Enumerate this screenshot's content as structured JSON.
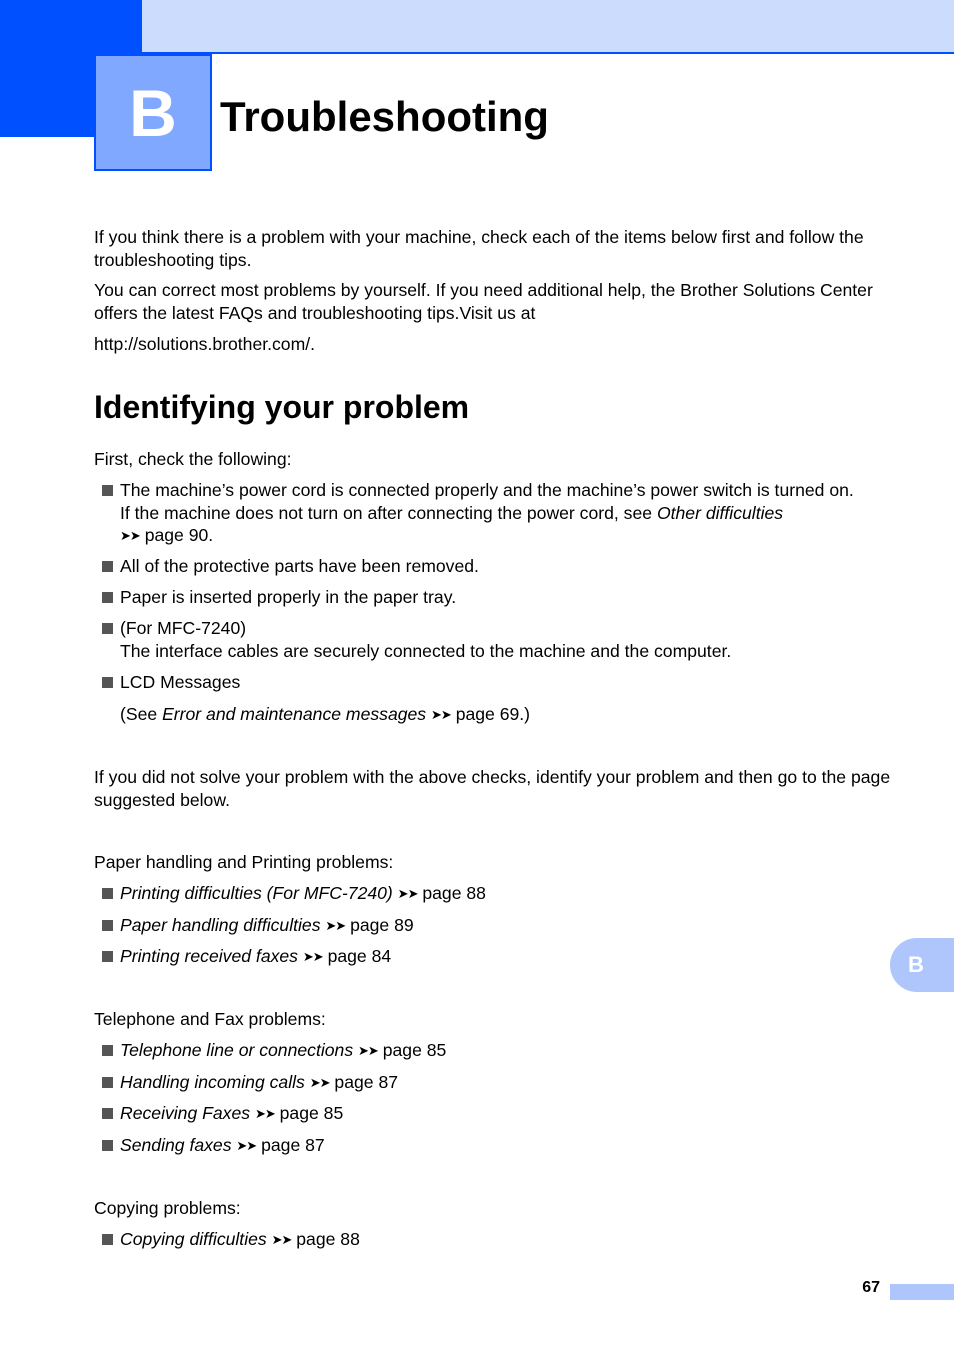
{
  "header": {
    "chapter_letter": "B",
    "chapter_title": "Troubleshooting",
    "colors": {
      "primary": "#0050ff",
      "light": "#ccdcfc",
      "box": "#80a8ff",
      "tab": "#aec6fc"
    }
  },
  "intro": {
    "p1": "If you think there is a problem with your machine, check each of the items below first and follow the troubleshooting tips.",
    "p2": "You can correct most problems by yourself. If you need additional help, the Brother Solutions Center offers the latest FAQs and troubleshooting tips.Visit us at",
    "url": "http://solutions.brother.com/."
  },
  "section": {
    "title": "Identifying your problem",
    "check_intro": "First, check the following:",
    "checks": [
      {
        "line1": "The machine’s power cord is connected properly and the machine’s power switch is turned on.",
        "line2_pre": "If the machine does not turn on after connecting the power cord, see ",
        "link": "Other difficulties",
        "arrow": "➤➤",
        "page": "page 90."
      },
      {
        "text": "All of the protective parts have been removed."
      },
      {
        "text": "Paper is inserted properly in the paper tray."
      },
      {
        "line1": "(For MFC-7240)",
        "line2": "The interface cables are securely connected to the machine and the computer."
      },
      {
        "text": "LCD Messages",
        "sub_pre": "(See ",
        "link": "Error and maintenance messages",
        "arrow": "➤➤",
        "page": "page 69.)"
      }
    ],
    "identify_intro": "If you did not solve your problem with the above checks, identify your problem and then go to the page suggested below.",
    "groups": [
      {
        "title": "Paper handling and Printing problems:",
        "items": [
          {
            "link": "Printing difficulties (For MFC-7240)",
            "arrow": "➤➤",
            "page": "page 88"
          },
          {
            "link": "Paper handling difficulties",
            "arrow": "➤➤",
            "page": "page 89"
          },
          {
            "link": "Printing received faxes",
            "arrow": "➤➤",
            "page": "page 84"
          }
        ]
      },
      {
        "title": "Telephone and Fax problems:",
        "items": [
          {
            "link": "Telephone line or connections",
            "arrow": "➤➤",
            "page": "page 85"
          },
          {
            "link": "Handling incoming calls",
            "arrow": "➤➤",
            "page": "page 87"
          },
          {
            "link": "Receiving Faxes",
            "arrow": "➤➤",
            "page": "page 85"
          },
          {
            "link": "Sending faxes",
            "arrow": "➤➤",
            "page": "page 87"
          }
        ]
      },
      {
        "title": "Copying problems:",
        "items": [
          {
            "link": "Copying difficulties",
            "arrow": "➤➤",
            "page": "page 88"
          }
        ]
      }
    ]
  },
  "footer": {
    "side_tab": "B",
    "page_number": "67"
  }
}
